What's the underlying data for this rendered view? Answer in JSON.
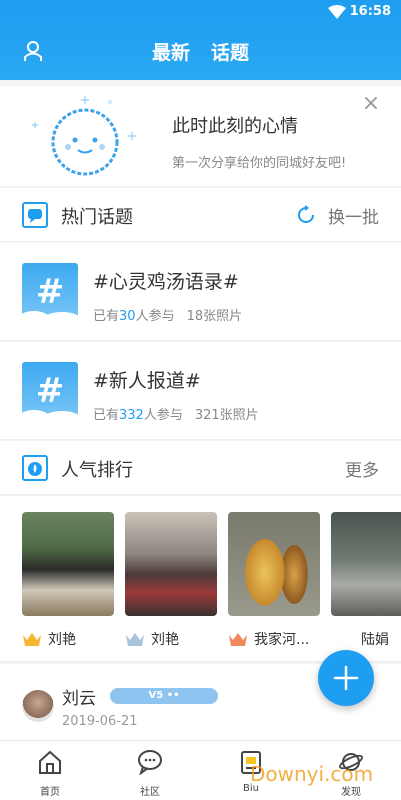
{
  "status_bar": {
    "time": "16:58"
  },
  "header": {
    "tabs": [
      {
        "label": "最新"
      },
      {
        "label": "话题"
      }
    ]
  },
  "mood_card": {
    "title": "此时此刻的心情",
    "subtitle": "第一次分享给你的同城好友吧!",
    "close": "×"
  },
  "hot_topics": {
    "title": "热门话题",
    "action": "换一批",
    "items": [
      {
        "title": "#心灵鸡汤语录#",
        "prefix": "已有",
        "count": "30",
        "suffix": "人参与",
        "photos": "18张照片"
      },
      {
        "title": "#新人报道#",
        "prefix": "已有",
        "count": "332",
        "suffix": "人参与",
        "photos": "321张照片"
      }
    ]
  },
  "popularity": {
    "title": "人气排行",
    "more": "更多",
    "items": [
      {
        "name": "刘艳",
        "crown_color": "#f5b82e"
      },
      {
        "name": "刘艳",
        "crown_color": "#a9c4dc"
      },
      {
        "name": "我家河...",
        "crown_color": "#f08a5d"
      },
      {
        "name": "陆娟",
        "crown_color": ""
      }
    ]
  },
  "post": {
    "user": "刘云",
    "badge": "V5 ••",
    "date": "2019-06-21"
  },
  "bottom_nav": [
    {
      "label": "首页"
    },
    {
      "label": "社区"
    },
    {
      "label": "Biu"
    },
    {
      "label": "发现"
    }
  ],
  "watermark": "Downyi.com",
  "colors": {
    "accent": "#1e9ef0",
    "header": "#2aa8f3"
  }
}
